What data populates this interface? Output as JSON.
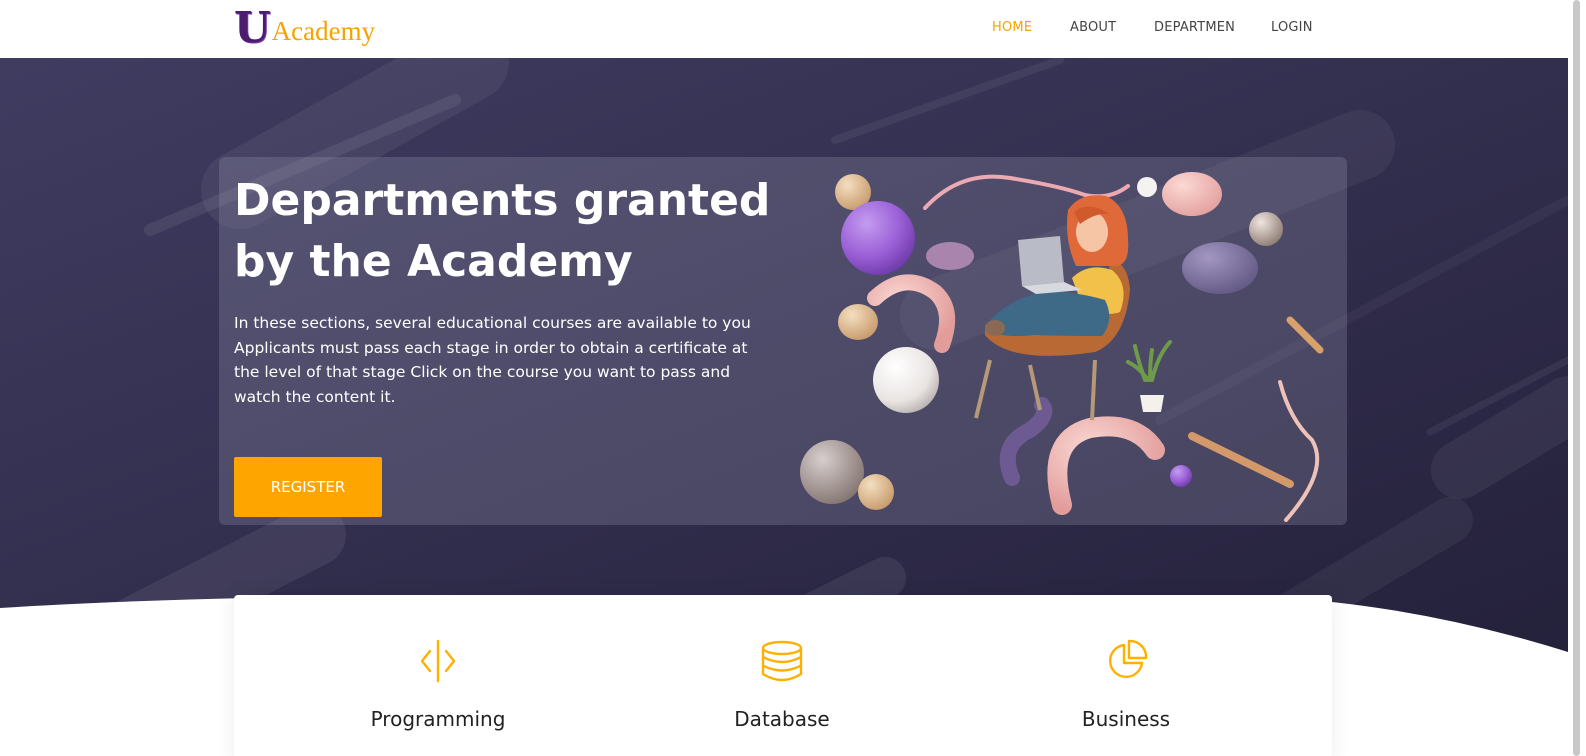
{
  "brand": {
    "logo_letter": "U",
    "logo_text": "Academy"
  },
  "nav": {
    "items": [
      {
        "label": "HOME",
        "active": true
      },
      {
        "label": "ABOUT",
        "active": false
      },
      {
        "label": "DEPARTMEN",
        "active": false
      },
      {
        "label": "LOGIN",
        "active": false
      }
    ]
  },
  "hero": {
    "title": "Departments granted by the Academy",
    "description": "In these sections, several educational courses are available to you Applicants must pass each stage in order to obtain a certificate at the level of that stage Click on the course you want to pass and watch the content it.",
    "register_label": "REGISTER",
    "illustration": "girl-with-laptop-on-chair-3d-illustration"
  },
  "features": [
    {
      "icon": "code-icon",
      "title": "Programming",
      "subtitle": ""
    },
    {
      "icon": "database-icon",
      "title": "Database",
      "subtitle": ""
    },
    {
      "icon": "pie-chart-icon",
      "title": "Business",
      "subtitle": ""
    }
  ],
  "colors": {
    "accent": "#ffa500",
    "hero_bg": "#2f2b4d",
    "logo_purple": "#4a1d6e",
    "nav_text": "#444444"
  }
}
